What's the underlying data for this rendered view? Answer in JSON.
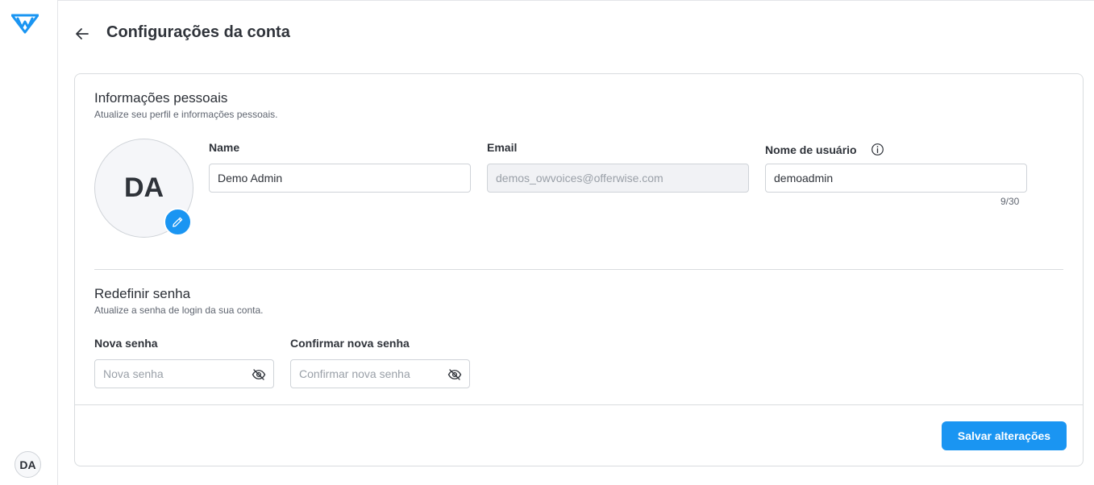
{
  "header": {
    "title": "Configurações da conta"
  },
  "sidebar": {
    "user_initials": "DA"
  },
  "personal": {
    "title": "Informações pessoais",
    "subtitle": "Atualize seu perfil e informações pessoais.",
    "avatar_initials": "DA",
    "name_label": "Name",
    "name_value": "Demo Admin",
    "email_label": "Email",
    "email_value": "demos_owvoices@offerwise.com",
    "username_label": "Nome de usuário",
    "username_value": "demoadmin",
    "username_counter": "9/30"
  },
  "password": {
    "title": "Redefinir senha",
    "subtitle": "Atualize a senha de login da sua conta.",
    "new_label": "Nova senha",
    "new_placeholder": "Nova senha",
    "confirm_label": "Confirmar nova senha",
    "confirm_placeholder": "Confirmar nova senha"
  },
  "footer": {
    "save_label": "Salvar alterações"
  },
  "colors": {
    "accent": "#1a95f2",
    "logo": "#1a95f2"
  }
}
